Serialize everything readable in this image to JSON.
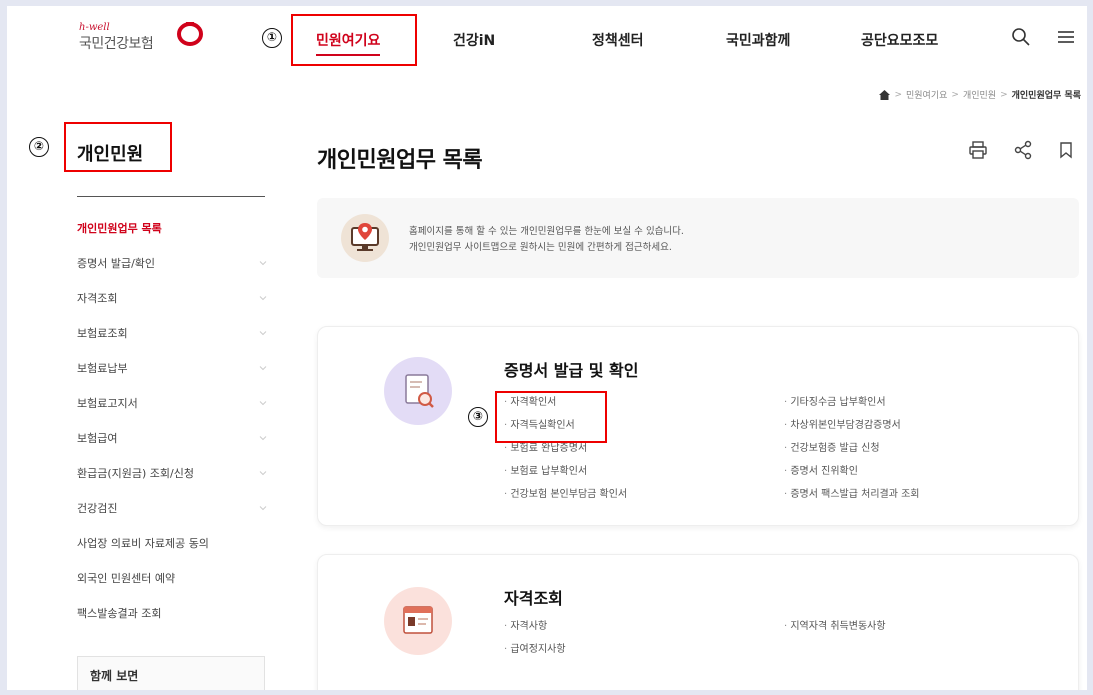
{
  "header": {
    "logo_small": "h-well",
    "logo_text": "국민건강보험",
    "nav": [
      "민원여기요",
      "건강iN",
      "정책센터",
      "국민과함께",
      "공단요모조모"
    ]
  },
  "annotations": [
    "①",
    "②",
    "③"
  ],
  "breadcrumb": [
    "민원여기요",
    "개인민원",
    "개인민원업무 목록"
  ],
  "sidebar": {
    "title": "개인민원",
    "items": [
      {
        "label": "개인민원업무 목록"
      },
      {
        "label": "증명서 발급/확인"
      },
      {
        "label": "자격조회"
      },
      {
        "label": "보험료조회"
      },
      {
        "label": "보험료납부"
      },
      {
        "label": "보험료고지서"
      },
      {
        "label": "보험급여"
      },
      {
        "label": "환급금(지원금) 조회/신청"
      },
      {
        "label": "건강검진"
      },
      {
        "label": "사업장 의료비 자료제공 동의"
      },
      {
        "label": "외국인 민원센터 예약"
      },
      {
        "label": "팩스발송결과 조회"
      }
    ],
    "related_title": "함께 보면"
  },
  "main": {
    "title": "개인민원업무 목록",
    "intro": {
      "line1": "홈페이지를 통해 할 수 있는 개인민원업무를 한눈에 보실 수 있습니다.",
      "line2": "개인민원업무 사이트맵으로 원하시는 민원에 간편하게 접근하세요."
    },
    "sections": [
      {
        "title": "증명서 발급 및 확인",
        "left": [
          "자격확인서",
          "자격득실확인서",
          "보험료 완납증명서",
          "보험료 납부확인서",
          "건강보험 본인부담금 확인서"
        ],
        "right": [
          "기타징수금 납부확인서",
          "차상위본인부담경감증명서",
          "건강보험증 발급 신청",
          "증명서 진위확인",
          "증명서 팩스발급 처리결과 조회"
        ]
      },
      {
        "title": "자격조회",
        "left": [
          "자격사항",
          "급여정지사항"
        ],
        "right": [
          "지역자격 취득변동사항"
        ]
      }
    ]
  },
  "colors": {
    "accent": "#d0021b",
    "annotation": "#e00000"
  }
}
